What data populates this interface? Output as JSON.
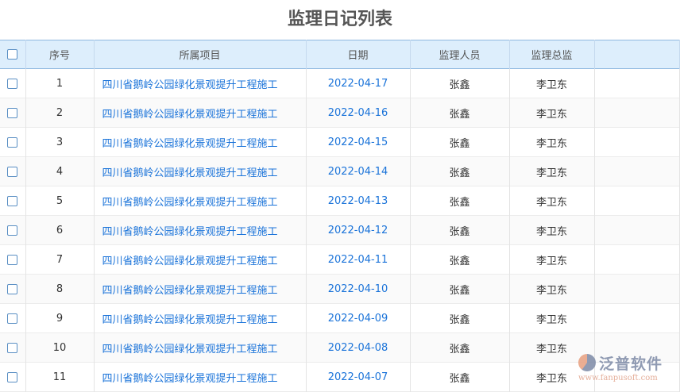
{
  "title": "监理日记列表",
  "columns": [
    "序号",
    "所属项目",
    "日期",
    "监理人员",
    "监理总监"
  ],
  "rows": [
    {
      "no": "1",
      "project": "四川省鹅岭公园绿化景观提升工程施工",
      "date": "2022-04-17",
      "staff": "张鑫",
      "chief": "李卫东"
    },
    {
      "no": "2",
      "project": "四川省鹅岭公园绿化景观提升工程施工",
      "date": "2022-04-16",
      "staff": "张鑫",
      "chief": "李卫东"
    },
    {
      "no": "3",
      "project": "四川省鹅岭公园绿化景观提升工程施工",
      "date": "2022-04-15",
      "staff": "张鑫",
      "chief": "李卫东"
    },
    {
      "no": "4",
      "project": "四川省鹅岭公园绿化景观提升工程施工",
      "date": "2022-04-14",
      "staff": "张鑫",
      "chief": "李卫东"
    },
    {
      "no": "5",
      "project": "四川省鹅岭公园绿化景观提升工程施工",
      "date": "2022-04-13",
      "staff": "张鑫",
      "chief": "李卫东"
    },
    {
      "no": "6",
      "project": "四川省鹅岭公园绿化景观提升工程施工",
      "date": "2022-04-12",
      "staff": "张鑫",
      "chief": "李卫东"
    },
    {
      "no": "7",
      "project": "四川省鹅岭公园绿化景观提升工程施工",
      "date": "2022-04-11",
      "staff": "张鑫",
      "chief": "李卫东"
    },
    {
      "no": "8",
      "project": "四川省鹅岭公园绿化景观提升工程施工",
      "date": "2022-04-10",
      "staff": "张鑫",
      "chief": "李卫东"
    },
    {
      "no": "9",
      "project": "四川省鹅岭公园绿化景观提升工程施工",
      "date": "2022-04-09",
      "staff": "张鑫",
      "chief": "李卫东"
    },
    {
      "no": "10",
      "project": "四川省鹅岭公园绿化景观提升工程施工",
      "date": "2022-04-08",
      "staff": "张鑫",
      "chief": "李卫东"
    },
    {
      "no": "11",
      "project": "四川省鹅岭公园绿化景观提升工程施工",
      "date": "2022-04-07",
      "staff": "张鑫",
      "chief": "李卫东"
    }
  ],
  "logo": {
    "name": "泛普软件",
    "url": "www.fanpusoft.com"
  }
}
